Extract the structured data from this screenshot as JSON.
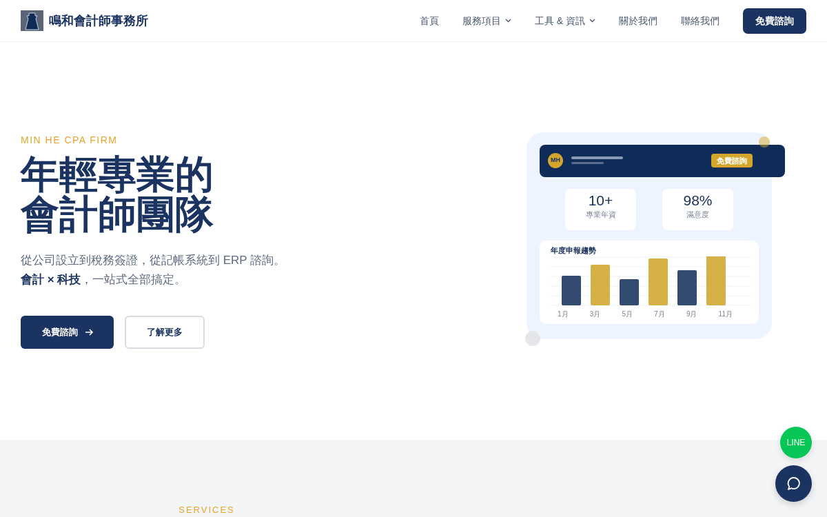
{
  "navbar": {
    "brand": "鳴和會計師事務所",
    "links": [
      {
        "label": "首頁",
        "dropdown": false
      },
      {
        "label": "服務項目",
        "dropdown": true
      },
      {
        "label": "工具 & 資訊",
        "dropdown": true
      },
      {
        "label": "關於我們",
        "dropdown": false
      },
      {
        "label": "聯絡我們",
        "dropdown": false
      }
    ],
    "cta": "免費諮詢"
  },
  "hero": {
    "eyebrow": "MIN HE CPA FIRM",
    "title_lines": [
      "年輕專業的",
      "會計師團隊"
    ],
    "lead_lines": [
      "從公司設立到稅務簽證，從記帳系統到 ERP 諮詢。",
      "**會計 × 科技**，一站式全部搞定。"
    ],
    "primary_button": "免費諮詢",
    "secondary_button": "了解更多"
  },
  "mockup": {
    "avatar": "MH",
    "header_button": "免費諮詢",
    "stats": [
      {
        "value": "10+",
        "label": "專業年資"
      },
      {
        "value": "98%",
        "label": "滿意度"
      }
    ],
    "chart_title": "年度申報趨勢",
    "month_labels": [
      "1月",
      "3月",
      "5月",
      "7月",
      "9月",
      "11月"
    ]
  },
  "services": {
    "eyebrow": "SERVICES"
  },
  "floating": {
    "line_label": "LINE"
  }
}
